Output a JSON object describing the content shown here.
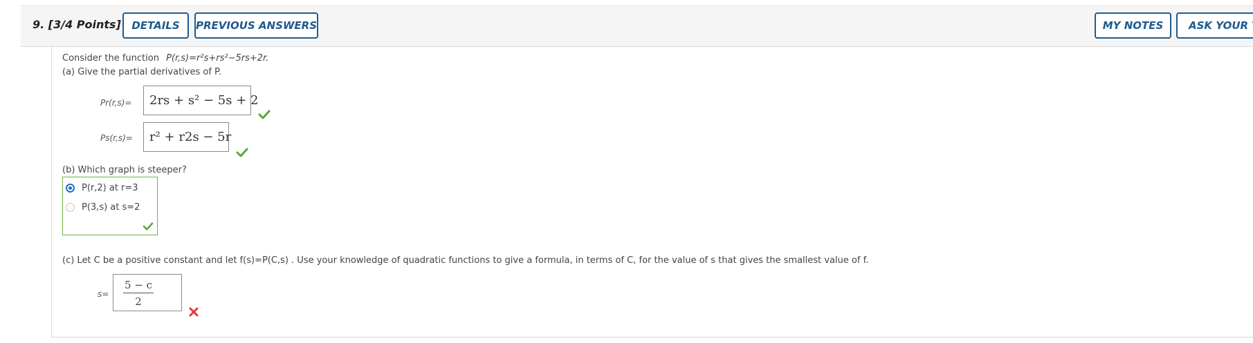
{
  "header": {
    "question_number": "9. [3/4 Points]",
    "buttons": {
      "details": "DETAILS",
      "previous_answers": "PREVIOUS ANSWERS",
      "my_notes": "MY NOTES",
      "ask_teacher": "ASK YOUR TE"
    }
  },
  "problem": {
    "intro_prefix": "Consider the function",
    "function": "P(r,s)=r²s+rs²−5rs+2r.",
    "part_a_prompt": "(a) Give the partial derivatives of P.",
    "pr_label": "Pr(r,s)=",
    "pr_answer": "2rs + s² − 5s + 2",
    "ps_label": "Ps(r,s)=",
    "ps_answer": "r² + r2s − 5r",
    "part_b_prompt": "(b) Which graph is steeper?",
    "options": [
      "P(r,2) at r=3",
      "P(3,s) at s=2"
    ],
    "selected_option": 0,
    "part_c_prompt": "(c) Let C be a positive constant and let  f(s)=P(C,s) . Use your knowledge of quadratic functions to give a formula, in terms of C, for the value of s that gives the smallest value of f.",
    "s_label": "s=",
    "s_answer_numerator": "5 − c",
    "s_answer_denominator": "2"
  },
  "colors": {
    "button_border": "#1f5a8c",
    "correct_green": "#5aa63a",
    "incorrect_red": "#e8333a",
    "radio_blue": "#1b6fc9"
  }
}
